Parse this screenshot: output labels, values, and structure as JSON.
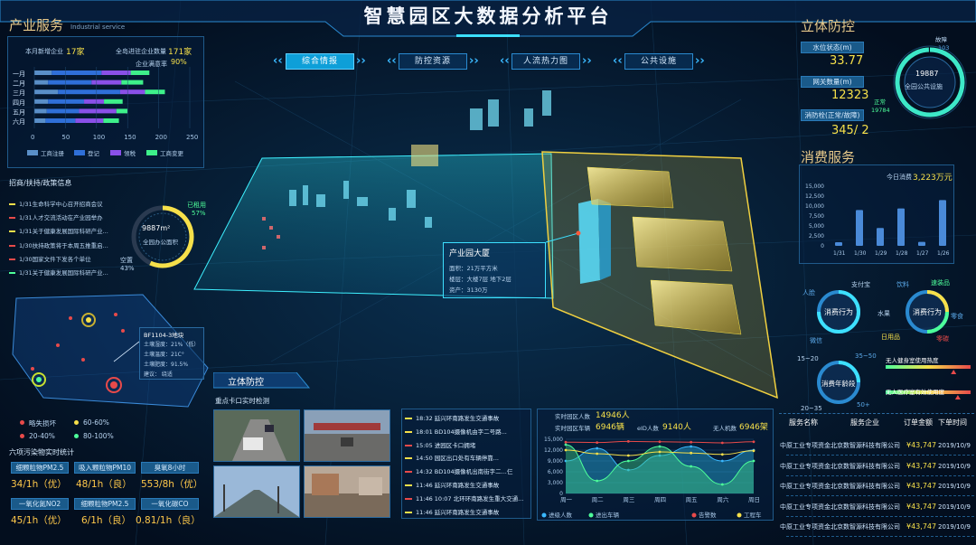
{
  "header": {
    "title": "智慧园区大数据分析平台"
  },
  "tabs": [
    {
      "label": "综合情报",
      "active": true
    },
    {
      "label": "防控资源",
      "active": false
    },
    {
      "label": "人流热力图",
      "active": false
    },
    {
      "label": "公共设施",
      "active": false
    }
  ],
  "industry": {
    "title": "产业服务",
    "title_en": "Industrial service",
    "new_label": "本月新增企业",
    "new_value": "17家",
    "total_label": "全岛进驻企业数量",
    "total_value": "171家",
    "full_label": "企业满意率",
    "full_value": "90%",
    "legend": [
      "工商注册",
      "登记",
      "领税",
      "工商变更"
    ],
    "axis_ticks": [
      "0",
      "50",
      "100",
      "150",
      "200",
      "250"
    ]
  },
  "chart_data": [
    {
      "type": "bar",
      "orientation": "horizontal",
      "stacked": true,
      "categories": [
        "一月",
        "二月",
        "三月",
        "四月",
        "五月",
        "六月"
      ],
      "series": [
        {
          "name": "工商注册",
          "values": [
            28,
            22,
            38,
            22,
            20,
            18
          ]
        },
        {
          "name": "登记",
          "values": [
            80,
            70,
            100,
            58,
            52,
            48
          ]
        },
        {
          "name": "领税",
          "values": [
            47,
            48,
            40,
            32,
            60,
            45
          ]
        },
        {
          "name": "工商变更",
          "values": [
            30,
            35,
            32,
            30,
            18,
            25
          ]
        }
      ],
      "xlim": [
        0,
        250
      ],
      "colors": [
        "#5a8fc8",
        "#2f6fd8",
        "#8a50e8",
        "#3ef08a"
      ]
    },
    {
      "type": "bar",
      "title": "今日消费",
      "categories": [
        "1/31",
        "1/30",
        "1/29",
        "1/28",
        "1/27",
        "1/26"
      ],
      "values": [
        900,
        9000,
        4500,
        9400,
        1000,
        11500
      ],
      "ylim": [
        0,
        15000
      ],
      "yticks": [
        "15,000",
        "12,500",
        "10,000",
        "7,500",
        "5,000",
        "2,500",
        "0"
      ]
    },
    {
      "type": "area",
      "categories": [
        "周一",
        "周二",
        "周三",
        "周四",
        "周五",
        "周六",
        "周日"
      ],
      "series": [
        {
          "name": "进级人数",
          "values": [
            9000,
            12500,
            6500,
            10500,
            13000,
            9000,
            12000
          ]
        },
        {
          "name": "进出车辆",
          "values": [
            13500,
            3500,
            9000,
            13000,
            7500,
            2500,
            9000
          ]
        },
        {
          "name": "告警数",
          "values": [
            14200,
            14100,
            14400,
            14300,
            14200,
            14000,
            14300
          ]
        },
        {
          "name": "工程车",
          "values": [
            12000,
            11000,
            10500,
            11500,
            11200,
            10800,
            11800
          ]
        }
      ],
      "ylim": [
        0,
        15000
      ],
      "yticks": [
        "15,000",
        "12,000",
        "9,000",
        "6,000",
        "3,000",
        "0"
      ]
    }
  ],
  "policy": {
    "title": "招商/扶持/政策信息",
    "items": [
      {
        "text": "1/31生命科学中心召开招商会议",
        "color": "#f6e04a"
      },
      {
        "text": "1/31人才交流活动在产业园举办",
        "color": "#e84a4a"
      },
      {
        "text": "1/31关于健康发展国际科研产业...",
        "color": "#f6e04a"
      },
      {
        "text": "1/30扶持政策将于本周五推重启...",
        "color": "#e84a4a"
      },
      {
        "text": "1/30国家文件下发各个单位",
        "color": "#e84a4a"
      },
      {
        "text": "1/31关于健康发展国际科研产业...",
        "color": "#4dff9a"
      }
    ]
  },
  "office": {
    "area": "9887m²",
    "label": "全园办公面积",
    "used_label": "已租用",
    "used_pct": "57%",
    "empty_label": "空置",
    "empty_pct": "43%",
    "used_fraction": 0.57
  },
  "soil": {
    "plot": "BF1104-3地块",
    "lines": [
      "土壤湿度：21%（低）",
      "土壤温度：21C°",
      "土壤肥度：91.5%",
      "建议：      绕适"
    ]
  },
  "soil_legend": [
    "略失损坏",
    "60-60%",
    "20-40%",
    "80-100%"
  ],
  "env": {
    "title": "六项污染物实时统计",
    "items": [
      {
        "label": "细颗粒物PM2.5",
        "value": "34/1h（优）"
      },
      {
        "label": "吸入颗粒物PM10",
        "value": "48/1h（良）"
      },
      {
        "label": "臭氧8小时",
        "value": "553/8h（优）"
      },
      {
        "label": "一氧化氮NO2",
        "value": "45/1h（优）"
      },
      {
        "label": "细颗粒物PM2.5",
        "value": "6/1h（良）"
      },
      {
        "label": "一氧化碳CO",
        "value": "0.81/1h（良）"
      }
    ]
  },
  "building": {
    "title": "产业园大厦",
    "lines": [
      "面积：21万平方米",
      "楼层：大楼7层    地下2层",
      "资产：3130万"
    ]
  },
  "security": {
    "title": "立体防控",
    "cam_title": "重点卡口实时检测",
    "events": [
      {
        "text": "18:32 延兴环南路发生交通事故",
        "color": "#f6e04a"
      },
      {
        "text": "18:01 BD104摄像机由字二号路...",
        "color": "#f6e04a"
      },
      {
        "text": "15:05 进园区卡口拥堵",
        "color": "#e84a4a"
      },
      {
        "text": "14:50 园区出口处有车辆停靠...",
        "color": "#f6e04a"
      },
      {
        "text": "14:32 BD104摄像机出南街字二...仨",
        "color": "#e84a4a"
      },
      {
        "text": "11:46 延兴环南路发生交通事故",
        "color": "#f6e04a"
      },
      {
        "text": "11:46 10:07 北环环南路发生重大交通...",
        "color": "#e84a4a"
      },
      {
        "text": "11:46 延兴环南路发生交通事故",
        "color": "#f6e04a"
      }
    ]
  },
  "traffic": {
    "people_label": "实时园区人数",
    "people_value": "14946人",
    "cars_label": "实时园区车辆",
    "cars_value": "6946辆",
    "id_label": "eID人数",
    "id_value": "9140人",
    "drone_label": "无人机数",
    "drone_value": "6946架"
  },
  "defense": {
    "title": "立体防控",
    "water_label": "水位状态(m)",
    "water_value": "33.77",
    "gateway_label": "网关数量(m)",
    "gateway_value": "12323",
    "fire_label": "消防栓(正常/故障)",
    "fire_value": "345/ 2",
    "total": "19887",
    "total_label": "全园公共设施",
    "fault_label": "故障",
    "fault_value": "103",
    "normal_label": "正常",
    "normal_value": "19784",
    "normal_fraction": 0.995
  },
  "consume": {
    "title": "消费服务",
    "today_label": "今日消费",
    "today_value": "3,223万元",
    "behavior1": "消费行为",
    "b1_tags": [
      "人脸",
      "支付宝",
      "微信"
    ],
    "behavior2": "消费行为",
    "b2_tags": [
      "饮料",
      "速装品",
      "水果",
      "零食",
      "日用品",
      "零碳"
    ],
    "age": "消费年龄段",
    "age_tags": [
      "15~20",
      "35~50",
      "20~35",
      "50+"
    ],
    "hot1": "无人健身室使用热度",
    "hot2": "无人医疗室有效使用度",
    "hot1_level": 0.8,
    "hot2_level": 0.85
  },
  "orders": {
    "headers": [
      "服务名称",
      "服务企业",
      "订单金额",
      "下单时间"
    ],
    "rows": [
      [
        "中原工业专项资金",
        "北京数智源科技有限公司",
        "¥43,747",
        "2019/10/9"
      ],
      [
        "中原工业专项资金",
        "北京数智源科技有限公司",
        "¥43,747",
        "2019/10/9"
      ],
      [
        "中原工业专项资金",
        "北京数智源科技有限公司",
        "¥43,747",
        "2019/10/9"
      ],
      [
        "中原工业专项资金",
        "北京数智源科技有限公司",
        "¥43,747",
        "2019/10/9"
      ],
      [
        "中原工业专项资金",
        "北京数智源科技有限公司",
        "¥43,747",
        "2019/10/9"
      ]
    ]
  },
  "colors": {
    "accent": "#3de0ff",
    "gold": "#e8c98a",
    "yellow": "#f6e04a",
    "green": "#4dff9a",
    "red": "#e84a4a"
  }
}
